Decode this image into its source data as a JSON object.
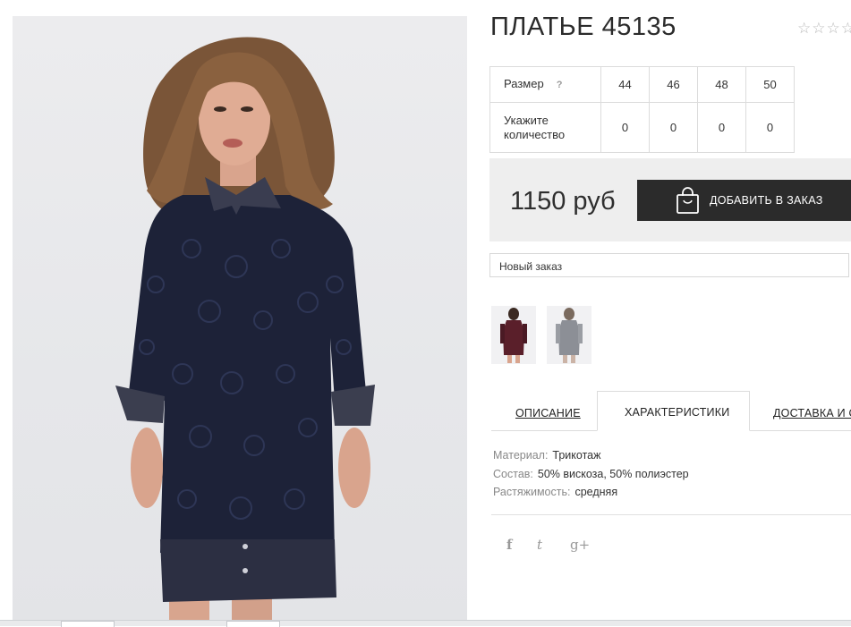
{
  "product": {
    "title": "ПЛАТЬЕ 45135",
    "rating_stars": "☆☆☆☆"
  },
  "sizes": {
    "size_label": "Размер",
    "help_label": "?",
    "qty_label": "Укажите количество",
    "items": [
      {
        "size": "44",
        "qty": "0"
      },
      {
        "size": "46",
        "qty": "0"
      },
      {
        "size": "48",
        "qty": "0"
      },
      {
        "size": "50",
        "qty": "0"
      }
    ]
  },
  "purchase": {
    "price": "1150 руб",
    "add_button": "ДОБАВИТЬ В ЗАКАЗ",
    "order_select_value": "Новый заказ"
  },
  "tabs": {
    "description": "ОПИСАНИЕ",
    "characteristics": "ХАРАКТЕРИСТИКИ",
    "delivery": "ДОСТАВКА И О"
  },
  "specs": [
    {
      "key": "Материал:",
      "value": "Трикотаж"
    },
    {
      "key": "Состав:",
      "value": "50% вискоза, 50% полиэстер"
    },
    {
      "key": "Растяжимость:",
      "value": "средняя"
    }
  ],
  "social": {
    "facebook": "f",
    "twitter": "t",
    "googleplus": "g+"
  },
  "colors": {
    "dress": "#1d2238",
    "button_bg": "#2b2b2b",
    "price_box_bg": "#eeeeee"
  }
}
